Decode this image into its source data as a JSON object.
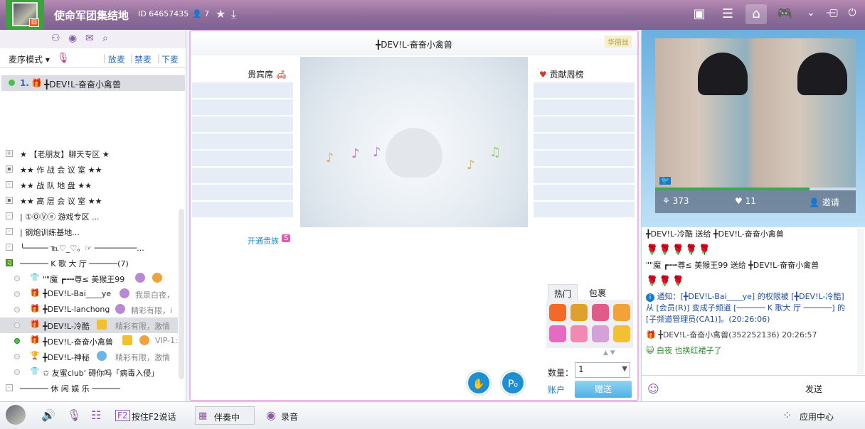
{
  "titlebar": {
    "room_name": "使命军团集结地",
    "room_id": "ID 64657435",
    "online_count": "7",
    "avatar_flag": "⊟"
  },
  "left": {
    "mic_mode_label": "麦序模式",
    "put_mic": "放麦",
    "ban_mic": "禁麦",
    "down_mic": "下麦",
    "queue_item": {
      "index": "1.",
      "name": "╋DEV!L-奋奋小禽兽"
    },
    "channels": [
      {
        "box": "+",
        "text": "★     【老朋友】聊天专区      ★"
      },
      {
        "box": "🔒",
        "text": "★★      作 战 会 议 室      ★★"
      },
      {
        "box": "·",
        "text": "★★      战  队  地  盘      ★★"
      },
      {
        "box": "🔒",
        "text": "★★      高 层 会 议 室      ★★"
      },
      {
        "box": "·",
        "text": "|      ①ⓄⓋⓔ      游戏专区    ..."
      },
      {
        "box": "·",
        "text": "|                    钢炮训练基地..."
      },
      {
        "box": "·",
        "text": "╰───── ℡♡_♡。☞ ─────────..."
      },
      {
        "box": "♫",
        "text": "────── K 歌 大 厅 ──────(7)"
      }
    ],
    "users": [
      {
        "name": "\"\"魔 ┏┅┅尊≤ 美猴王99",
        "sig": "",
        "online": false
      },
      {
        "name": "╋DEV!L-Bai____ye",
        "sig": "我是白夜，",
        "online": false
      },
      {
        "name": "╋DEV!L-lanchong",
        "sig": "精彩有限，i",
        "online": false
      },
      {
        "name": "╋DEV!L-冷酷",
        "sig": "精彩有限，激情",
        "online": false
      },
      {
        "name": "╋DEV!L-奋奋小禽兽",
        "sig": "VIP-1:",
        "online": true
      },
      {
        "name": "╋DEV!L-神秘",
        "sig": "精彩有限，激情",
        "online": false
      },
      {
        "name": "✩  友蜜club' 碍你吗「病毒入侵」",
        "sig": "",
        "online": false
      }
    ],
    "last_channel": "────── 休 闲 娱 乐 ──────"
  },
  "center": {
    "singer": "╋DEV!L-奋奋小禽兽",
    "gift_tag": "华丽丝",
    "vip_seat": "贵宾席",
    "contribution": "贡献周榜",
    "open_vip": "开通贵族",
    "open_vip_badge": "S",
    "gift_tabs": [
      "热门",
      "包裹"
    ],
    "qty_label": "数量：",
    "qty_value": "1",
    "account": "账户",
    "give": "赠送",
    "bottom_btn_2": "P₀"
  },
  "right": {
    "flowers": "373",
    "likes": "11",
    "invite": "邀请",
    "chat": [
      {
        "type": "line",
        "text": "╋DEV!L-冷酷 送给 ╋DEV!L-奋奋小禽兽"
      },
      {
        "type": "roses",
        "text": "🌹🌹🌹🌹🌹"
      },
      {
        "type": "line",
        "text": "\"\"魔 ┏┅┅尊≤ 美猴王99 送给 ╋DEV!L-奋奋小禽兽"
      },
      {
        "type": "roses",
        "text": "🌹🌹🌹"
      },
      {
        "type": "notice",
        "text": "通知：[╋DEV!L-Bai____ye] 的权限被 [╋DEV!L-冷酷] 从 [会员(R)] 变成子频道 [────── K 歌大 厅 ──────] 的 [子频道管理员(CA1)]。(20:26:06)"
      },
      {
        "type": "line",
        "text": "╋DEV!L-奋奋小禽兽(352252136) 20:26:57"
      },
      {
        "type": "greet",
        "text": "白夜   也换红裙子了"
      }
    ],
    "send": "发送"
  },
  "bottom": {
    "f2": "按住F2说话",
    "accomp": "伴奏中",
    "record": "录音",
    "app_center": "应用中心"
  },
  "colors": {
    "titlebar": "#8f6c9a",
    "accent_green": "#3fa03f",
    "link_blue": "#2a6ab2",
    "give_blue": "#4fb2e3"
  }
}
